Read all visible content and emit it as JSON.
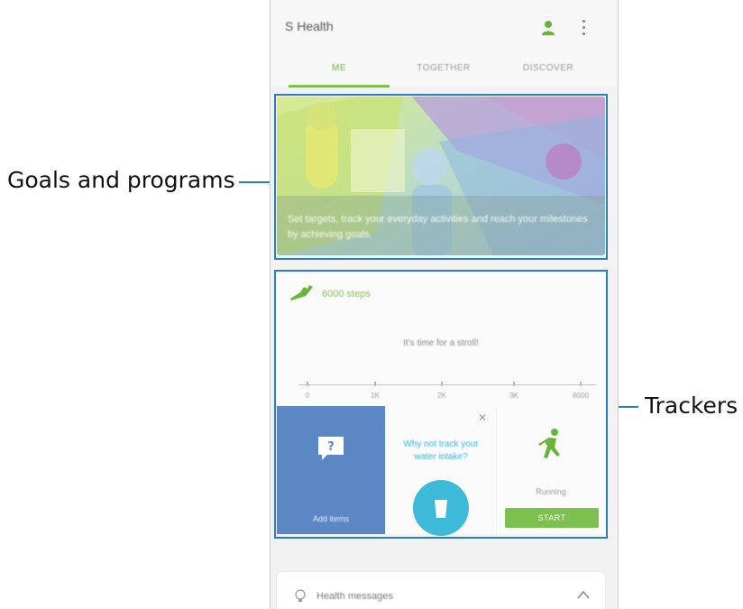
{
  "callouts": {
    "goals": "Goals and programs",
    "trackers": "Trackers"
  },
  "app": {
    "title": "S Health",
    "tabs": [
      {
        "label": "ME",
        "active": true
      },
      {
        "label": "TOGETHER",
        "active": false
      },
      {
        "label": "DISCOVER",
        "active": false
      }
    ]
  },
  "goals_card": {
    "text": "Set targets, track your everyday activities and reach your milestones by achieving goals."
  },
  "steps_card": {
    "title": "6000 steps",
    "message": "It's time for a stroll!",
    "scale": [
      "0",
      "1K",
      "2K",
      "3K",
      "6000"
    ]
  },
  "tiles": {
    "add_items_label": "Add items",
    "water_prompt": "Why not track your water intake?",
    "running_label": "Running",
    "start_label": "START"
  },
  "health_messages": {
    "label": "Health messages"
  },
  "colors": {
    "accent_green": "#7cc14d",
    "highlight_blue": "#2b7fb8",
    "tile_blue": "#5b87c5",
    "water_cyan": "#3dbad8"
  },
  "icons": [
    "profile-icon",
    "more-options-icon",
    "shoe-icon",
    "chat-bubble-question-icon",
    "close-icon",
    "cup-icon",
    "running-person-icon",
    "lightbulb-icon",
    "chevron-up-icon"
  ]
}
